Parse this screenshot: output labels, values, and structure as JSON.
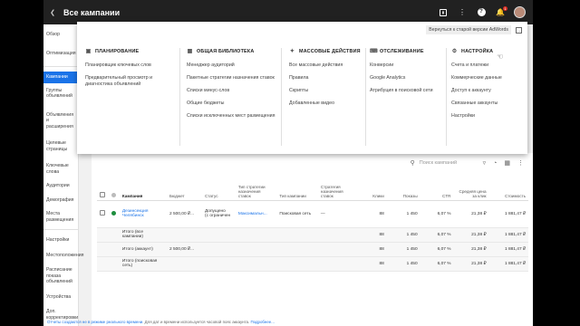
{
  "topbar": {
    "title": "Все кампании",
    "icons": [
      "chevron-left-icon",
      "chart-icon",
      "more-vert-icon",
      "help-icon",
      "notifications-icon",
      "account-avatar"
    ],
    "notification_count": "1"
  },
  "leftnav": {
    "items": [
      {
        "label": "Обзор",
        "active": false
      },
      {
        "label": "Оптимизация",
        "active": false
      },
      {
        "label": "Кампании",
        "active": true
      },
      {
        "label": "Группы объявлений",
        "active": false
      },
      {
        "label": "Объявления и расширения",
        "active": false
      },
      {
        "label": "Целевые страницы",
        "active": false
      },
      {
        "label": "Ключевые слова",
        "active": false
      },
      {
        "label": "Аудитории",
        "active": false
      },
      {
        "label": "Демография",
        "active": false
      },
      {
        "label": "Места размещения",
        "active": false
      },
      {
        "label": "Настройки",
        "active": false
      },
      {
        "label": "Местоположения",
        "active": false
      },
      {
        "label": "Расписание показа объявлений",
        "active": false
      },
      {
        "label": "Устройства",
        "active": false
      },
      {
        "label": "Доп. корректировки",
        "active": false
      }
    ]
  },
  "menu": {
    "back_label": "Вернуться к старой версии AdWords",
    "columns": [
      {
        "title": "ПЛАНИРОВАНИЕ",
        "icon": "calendar-icon",
        "items": [
          "Планировщик ключевых слов",
          "Предварительный просмотр и диагностика объявлений"
        ]
      },
      {
        "title": "ОБЩАЯ БИБЛИОТЕКА",
        "icon": "library-icon",
        "items": [
          "Менеджер аудиторий",
          "Пакетные стратегии назначения ставок",
          "Списки минус-слов",
          "Общие бюджеты",
          "Списки исключенных мест размещения"
        ]
      },
      {
        "title": "МАССОВЫЕ ДЕЙСТВИЯ",
        "icon": "bulk-actions-icon",
        "items": [
          "Все массовые действия",
          "Правила",
          "Скрипты",
          "Добавленные видео"
        ]
      },
      {
        "title": "ОТСЛЕЖИВАНИЕ",
        "icon": "tracking-icon",
        "items": [
          "Конверсии",
          "Google Analytics",
          "Атрибуция в поисковой сети"
        ]
      },
      {
        "title": "НАСТРОЙКА",
        "icon": "settings-icon",
        "items": [
          "Счета и платежи",
          "Коммерческие данные",
          "Доступ к аккаунту",
          "Связанные аккаунты",
          "Настройки"
        ]
      }
    ]
  },
  "toolbar": {
    "search_placeholder": "Поиск кампаний",
    "icons": [
      "search-icon",
      "filter-icon",
      "segment-icon",
      "columns-icon",
      "more-vert-icon"
    ]
  },
  "table": {
    "headers": [
      "Кампания",
      "Бюджет",
      "Статус",
      "Тип стратегии назначения ставок",
      "Тип кампании",
      "Стратегия назначения ставок",
      "Клики",
      "Показы",
      "CTR",
      "Средняя цена за клик",
      "Стоимость"
    ],
    "row": {
      "campaign": "Дезинсекция Челябинск",
      "budget": "2 500,00 ₽...",
      "status_1": "Допущено",
      "status_2": "(с ограничен",
      "bid_type": "Максимальн...",
      "campaign_type": "Поисковая сеть",
      "bid_strategy": "—",
      "clicks": "88",
      "impressions": "1 450",
      "ctr": "6,07 %",
      "cpc": "21,38 ₽",
      "cost": "1 881,47 ₽"
    },
    "totals": [
      {
        "label": "Итого (все кампании)",
        "budget": "",
        "clicks": "88",
        "impressions": "1 450",
        "ctr": "6,07 %",
        "cpc": "21,38 ₽",
        "cost": "1 881,47 ₽"
      },
      {
        "label": "Итого (аккаунт)",
        "budget": "2 500,00 ₽...",
        "clicks": "88",
        "impressions": "1 450",
        "ctr": "6,07 %",
        "cpc": "21,38 ₽",
        "cost": "1 881,47 ₽"
      },
      {
        "label": "Итого (поисковая сеть)",
        "budget": "",
        "clicks": "88",
        "impressions": "1 450",
        "ctr": "6,07 %",
        "cpc": "21,38 ₽",
        "cost": "1 881,47 ₽"
      }
    ]
  },
  "footer": {
    "text_1": "Отчеты создаются не в режиме реального времени.",
    "text_2": "Для дат и времени используется часовой пояс аккаунта.",
    "link": "Подробнее..."
  },
  "colors": {
    "topbar": "#212121",
    "accent": "#1a73e8",
    "status_ok": "#1e8e3e"
  }
}
